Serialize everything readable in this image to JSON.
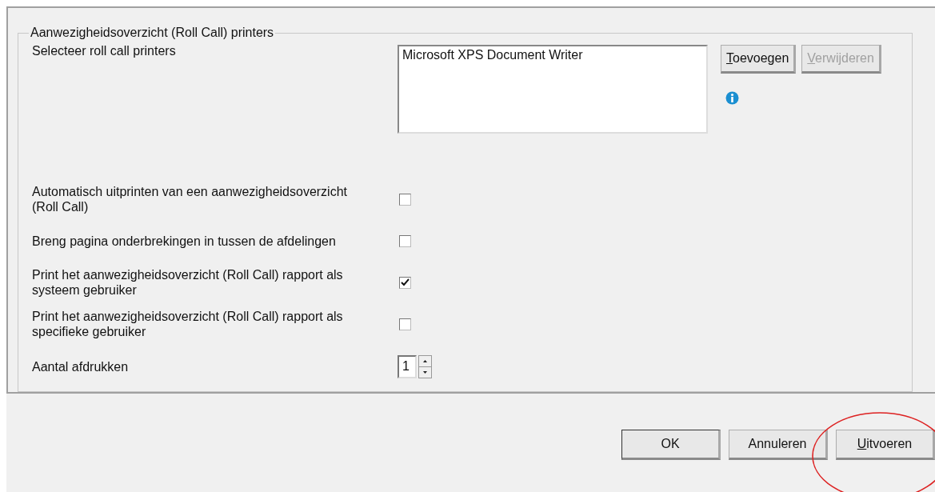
{
  "group": {
    "title": "Aanwezigheidsoverzicht (Roll Call) printers"
  },
  "printers": {
    "label": "Selecteer roll call printers",
    "items": [
      "Microsoft XPS Document Writer"
    ],
    "buttons": [
      {
        "label": "Toevoegen",
        "disabled": false,
        "underline_first": true
      },
      {
        "label": "Verwijderen",
        "disabled": true,
        "underline_first": true
      }
    ]
  },
  "options": [
    {
      "label": "Automatisch uitprinten van een aanwezigheidsoverzicht (Roll Call)",
      "checked": false
    },
    {
      "label": "Breng pagina onderbrekingen in tussen de afdelingen",
      "checked": false
    },
    {
      "label": "Print het aanwezigheidsoverzicht (Roll Call) rapport als systeem gebruiker",
      "checked": true
    },
    {
      "label": "Print het aanwezigheidsoverzicht (Roll Call) rapport als specifieke gebruiker",
      "checked": false
    }
  ],
  "copies": {
    "label": "Aantal afdrukken",
    "value": "1"
  },
  "footer_buttons": [
    {
      "label": "OK",
      "underline_first": false,
      "default": true,
      "highlighted": false
    },
    {
      "label": "Annuleren",
      "underline_first": false,
      "default": false,
      "highlighted": false
    },
    {
      "label": "Uitvoeren",
      "underline_first": true,
      "default": false,
      "highlighted": true
    }
  ]
}
